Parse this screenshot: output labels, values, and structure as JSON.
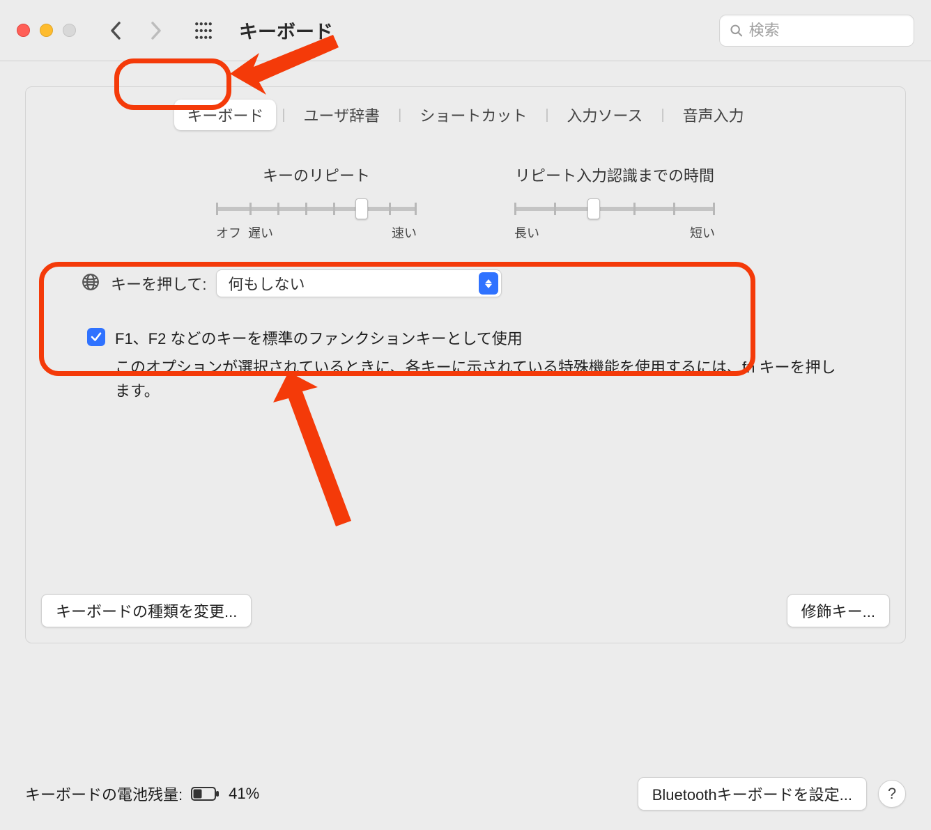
{
  "toolbar": {
    "title": "キーボード",
    "search_placeholder": "検索"
  },
  "tabs": {
    "items": [
      "キーボード",
      "ユーザ辞書",
      "ショートカット",
      "入力ソース",
      "音声入力"
    ]
  },
  "sliders": {
    "repeat": {
      "label": "キーのリピート",
      "left1": "オフ",
      "left2": "遅い",
      "right": "速い"
    },
    "delay": {
      "label": "リピート入力認識までの時間",
      "left": "長い",
      "right": "短い"
    }
  },
  "fn": {
    "label": "キーを押して:",
    "selected": "何もしない"
  },
  "checkbox": {
    "label": "F1、F2 などのキーを標準のファンクションキーとして使用",
    "desc": "このオプションが選択されているときに、各キーに示されている特殊機能を使用するには、fn キーを押します。"
  },
  "buttons": {
    "keyboard_type": "キーボードの種類を変更...",
    "modifier_keys": "修飾キー...",
    "bluetooth": "Bluetoothキーボードを設定..."
  },
  "footer": {
    "battery_label": "キーボードの電池残量:",
    "battery_pct": "41%"
  }
}
